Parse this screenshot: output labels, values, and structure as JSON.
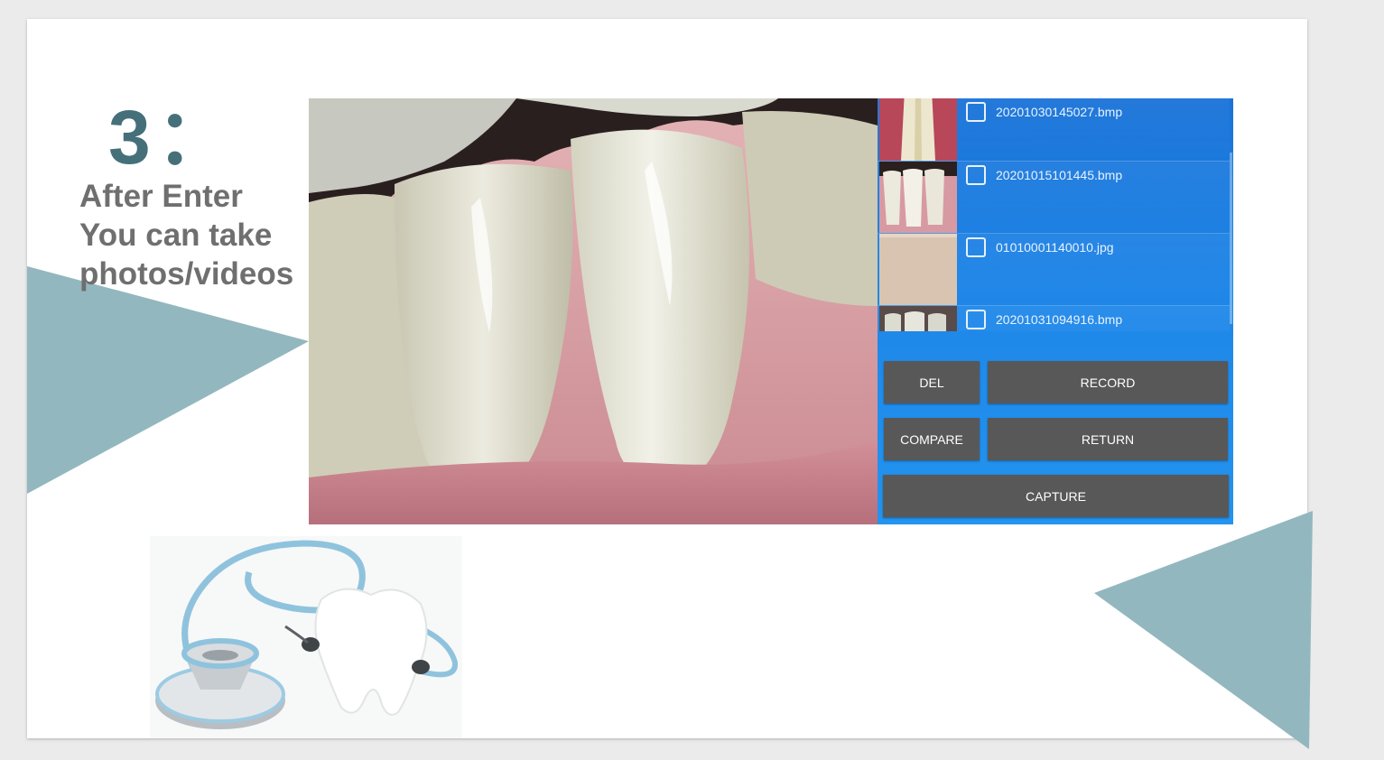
{
  "slide": {
    "step_number": "3：",
    "step_text_lines": [
      "After Enter",
      "You can take",
      "photos/videos"
    ]
  },
  "colors": {
    "accent_triangle": "#93b7be",
    "step_number": "#45707a",
    "panel_blue": "#1e86e8",
    "button_gray": "#585858"
  },
  "app": {
    "files": [
      {
        "name": "20201030145027.bmp"
      },
      {
        "name": "20201015101445.bmp"
      },
      {
        "name": "01010001140010.jpg"
      },
      {
        "name": "20201031094916.bmp"
      }
    ],
    "buttons": {
      "del": "DEL",
      "record": "RECORD",
      "compare": "COMPARE",
      "return": "RETURN",
      "capture": "CAPTURE"
    }
  },
  "icons": {
    "checkbox": "checkbox-icon",
    "decor": "stethoscope-tooth-image"
  }
}
